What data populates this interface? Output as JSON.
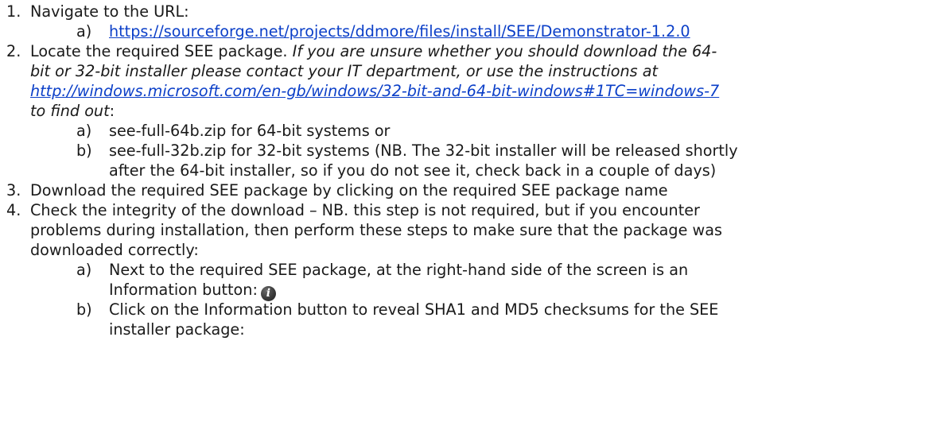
{
  "steps": [
    {
      "number": "1.",
      "text": "Navigate to the URL:",
      "substeps": [
        {
          "letter": "a)",
          "link": "https://sourceforge.net/projects/ddmore/files/install/SEE/Demonstrator-1.2.0"
        }
      ]
    },
    {
      "number": "2.",
      "lead": "Locate the required SEE package.",
      "italic_1": "If you are unsure whether you should download the 64-",
      "italic_2": "bit or 32-bit installer please contact your IT department, or use the instructions at",
      "link": "http://windows.microsoft.com/en-gb/windows/32-bit-and-64-bit-windows#1TC=windows-7",
      "italic_3": "to find out",
      "after_italic_3": ":",
      "substeps": [
        {
          "letter": "a)",
          "text": "see-full-64b.zip for 64-bit systems or"
        },
        {
          "letter": "b)",
          "text_1": "see-full-32b.zip for 32-bit systems (NB. The 32-bit installer will be released shortly",
          "text_2": "after the 64-bit installer, so if you do not see it, check back in a couple of days)"
        }
      ]
    },
    {
      "number": "3.",
      "text": "Download the required SEE package by clicking on the required SEE package name"
    },
    {
      "number": "4.",
      "text_1": "Check the integrity of the download – NB. this step is not required, but if you encounter",
      "text_2": "problems during installation, then perform these steps to make sure that the package was",
      "text_3": "downloaded correctly:",
      "substeps": [
        {
          "letter": "a)",
          "text_1": "Next to the required SEE package, at the right-hand side of the screen is an",
          "text_2": "Information button:",
          "icon": "information-icon",
          "icon_glyph": "i"
        },
        {
          "letter": "b)",
          "text_1": "Click on the Information button to reveal SHA1 and MD5 checksums for the SEE",
          "text_2": "installer package:"
        }
      ]
    }
  ]
}
